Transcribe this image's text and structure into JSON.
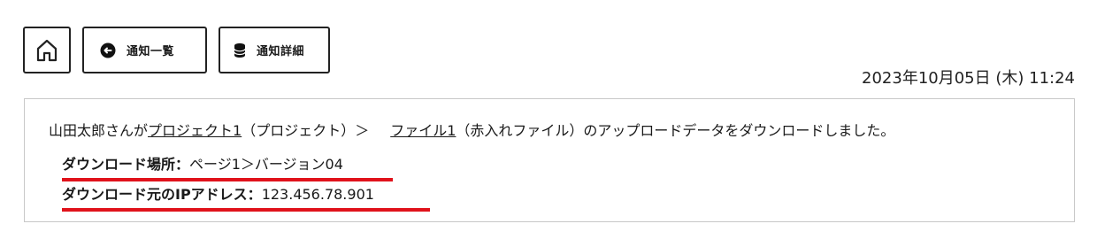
{
  "toolbar": {
    "home_icon": "home-icon",
    "list_icon": "back-circle-icon",
    "list_label": "通知一覧",
    "detail_icon": "database-icon",
    "detail_label": "通知詳細"
  },
  "datetime": "2023年10月05日 (木) 11:24",
  "notification": {
    "prefix": "山田太郎さんが",
    "project_link": "プロジェクト1",
    "project_suffix": "（プロジェクト）＞",
    "file_link": "ファイル1",
    "file_suffix": "（赤入れファイル）のアップロードデータをダウンロードしました。",
    "details": [
      {
        "label": "ダウンロード場所：",
        "value": "ページ1＞バージョン04"
      },
      {
        "label": "ダウンロード元のIPアドレス：",
        "value": "123.456.78.901"
      }
    ],
    "highlight_color": "#e0121b"
  }
}
